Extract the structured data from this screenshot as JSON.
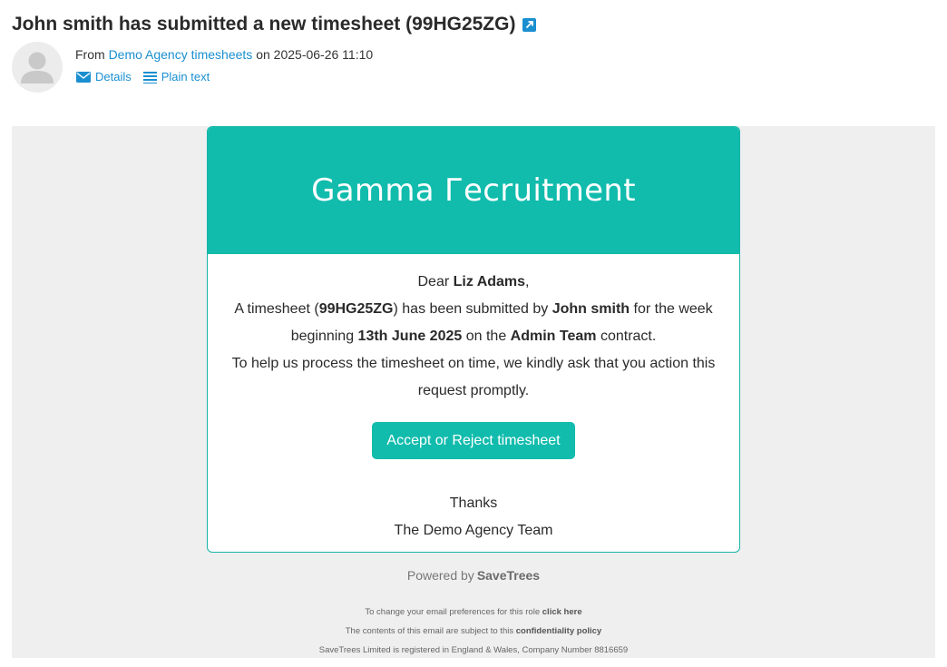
{
  "header": {
    "subject": "John smith has submitted a new timesheet (99HG25ZG)",
    "from_prefix": "From",
    "from_name": "Demo Agency timesheets",
    "date_prefix": "on",
    "date": "2025-06-26 11:10",
    "details_label": "Details",
    "plain_text_label": "Plain text"
  },
  "email": {
    "brand": "Gamma Гecruitment",
    "greeting_prefix": "Dear",
    "recipient": "Liz Adams",
    "greeting_suffix": ",",
    "line1_a": "A timesheet (",
    "timesheet_id": "99HG25ZG",
    "line1_b": ") has been submitted by",
    "submitter": "John smith",
    "line1_c": "for the week beginning",
    "week": "13th June 2025",
    "line1_d": "on the",
    "contract": "Admin Team",
    "line1_e": "contract.",
    "line2": "To help us process the timesheet on time, we kindly ask that you action this request promptly.",
    "cta_label": "Accept or Reject timesheet",
    "thanks": "Thanks",
    "team": "The Demo Agency Team"
  },
  "footer": {
    "powered_by": "Powered by",
    "powered_brand": "SaveTrees",
    "pref_text": "To change your email preferences for this role",
    "pref_link": "click here",
    "conf_text": "The contents of this email are subject to this",
    "conf_link": "confidentiality policy",
    "company_text": "SaveTrees Limited is registered in England & Wales, Company Number 8816659"
  },
  "colors": {
    "accent": "#11bcad",
    "link": "#1a8fd0",
    "background": "#efefef"
  },
  "icons": [
    "external-link-icon",
    "avatar-placeholder-icon",
    "envelope-icon",
    "lines-icon"
  ]
}
